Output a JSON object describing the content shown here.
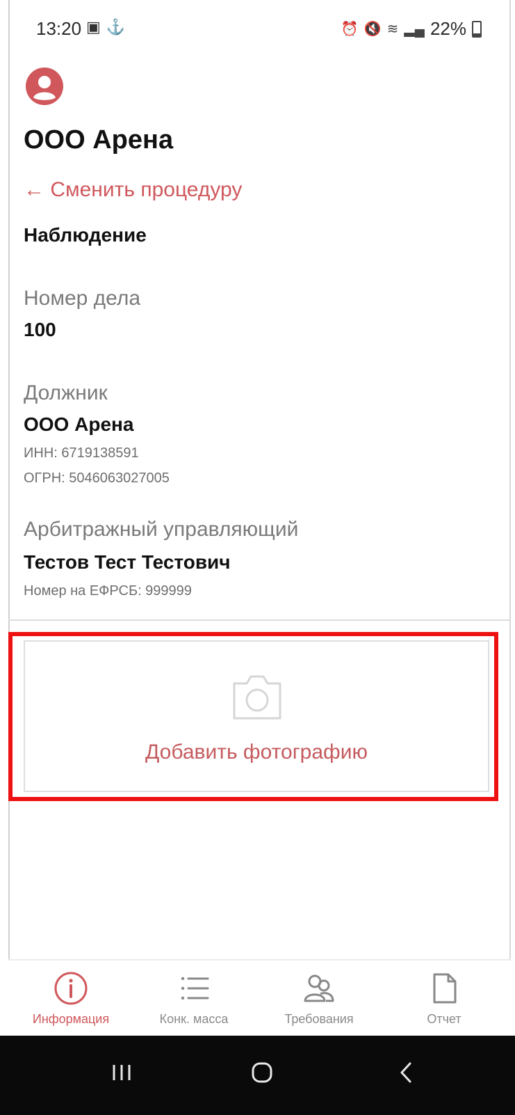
{
  "status_bar": {
    "time": "13:20",
    "battery": "22%",
    "left_icons": [
      "gallery-icon",
      "usb-icon"
    ],
    "right_icons": [
      "alarm-icon",
      "mute-icon",
      "wifi-icon",
      "signal-icon",
      "battery-icon"
    ]
  },
  "header": {
    "title": "ООО Арена",
    "change_procedure_link": "← Сменить процедуру",
    "procedure": "Наблюдение"
  },
  "case": {
    "number_label": "Номер дела",
    "number_value": "100"
  },
  "debtor": {
    "label": "Должник",
    "name": "ООО Арена",
    "inn": "ИНН:  6719138591",
    "ogrn": "ОГРН: 5046063027005"
  },
  "manager": {
    "label": "Арбитражный управляющий",
    "name": "Тестов Тест Тестович",
    "efrsb": "Номер на ЕФРСБ: 999999"
  },
  "photo": {
    "add_label": "Добавить фотографию"
  },
  "bottom_nav": {
    "items": [
      {
        "label": "Информация",
        "icon": "info-icon",
        "active": true
      },
      {
        "label": "Конк. масса",
        "icon": "list-icon",
        "active": false
      },
      {
        "label": "Требования",
        "icon": "users-icon",
        "active": false
      },
      {
        "label": "Отчет",
        "icon": "document-icon",
        "active": false
      }
    ]
  },
  "system_nav": [
    "recent-apps-icon",
    "home-icon",
    "back-icon"
  ],
  "colors": {
    "accent": "#d0585c",
    "highlight": "#ee1111",
    "muted_text": "#7a7a7a"
  }
}
